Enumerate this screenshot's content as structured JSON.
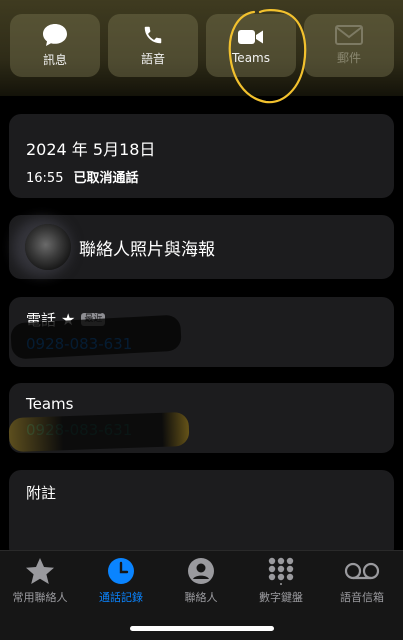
{
  "actions": [
    {
      "label": "訊息",
      "icon": "message-bubble-icon"
    },
    {
      "label": "語音",
      "icon": "phone-icon"
    },
    {
      "label": "Teams",
      "icon": "video-camera-icon"
    },
    {
      "label": "郵件",
      "icon": "envelope-icon"
    }
  ],
  "call": {
    "date": "2024 年 5月18日",
    "time": "16:55",
    "status": "已取消通話"
  },
  "contact_photo": {
    "label": "聯絡人照片與海報"
  },
  "phone": {
    "label": "電話",
    "badge": "最近",
    "number": "0928-083-631"
  },
  "teams": {
    "label": "Teams",
    "number": "0928-083-631"
  },
  "notes": {
    "label": "附註"
  },
  "tabs": [
    {
      "label": "常用聯絡人",
      "icon": "star-icon"
    },
    {
      "label": "通話記錄",
      "icon": "clock-icon",
      "active": true
    },
    {
      "label": "聯絡人",
      "icon": "person-circle-icon"
    },
    {
      "label": "數字鍵盤",
      "icon": "keypad-icon"
    },
    {
      "label": "語音信箱",
      "icon": "voicemail-icon"
    }
  ],
  "colors": {
    "accent": "#0a84ff",
    "annotation": "#f2c12e",
    "card": "#1c1c1e"
  }
}
